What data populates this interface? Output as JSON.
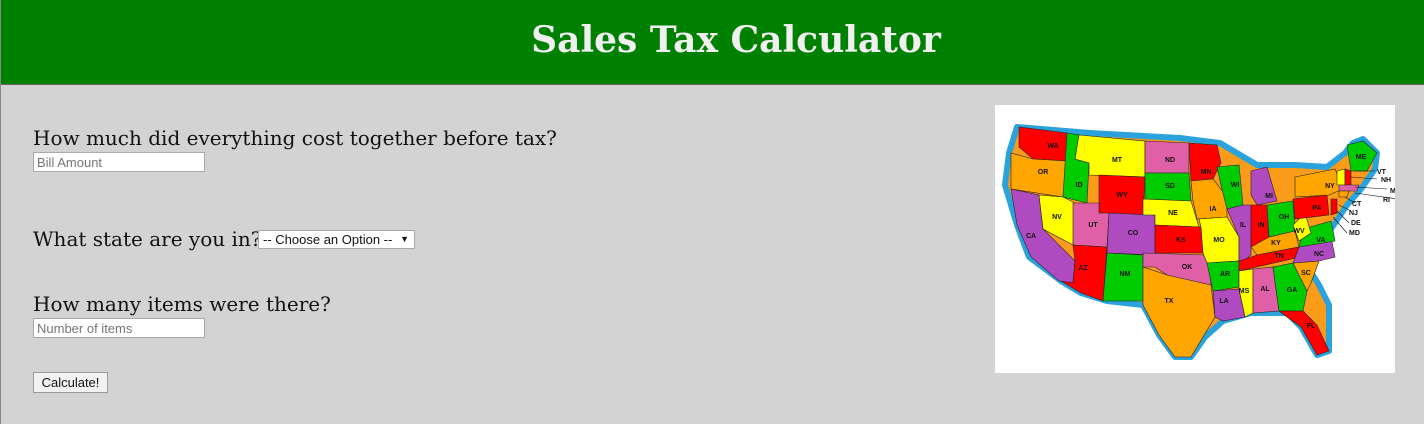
{
  "header": {
    "title": "Sales Tax Calculator"
  },
  "form": {
    "cost_question": "How much did everything cost together before tax?",
    "cost_placeholder": "Bill Amount",
    "state_question": "What state are you in?",
    "state_selected": "-- Choose an Option --",
    "items_question": "How many items were there?",
    "items_placeholder": "Number of items",
    "calculate_label": "Calculate!"
  },
  "map": {
    "state_labels": [
      "WA",
      "OR",
      "CA",
      "ID",
      "NV",
      "MT",
      "WY",
      "UT",
      "AZ",
      "CO",
      "NM",
      "ND",
      "SD",
      "NE",
      "KS",
      "OK",
      "TX",
      "MN",
      "IA",
      "MO",
      "AR",
      "LA",
      "WI",
      "IL",
      "MI",
      "IN",
      "OH",
      "KY",
      "TN",
      "MS",
      "AL",
      "GA",
      "FL",
      "SC",
      "NC",
      "VA",
      "WV",
      "PA",
      "NY",
      "ME",
      "VT",
      "NH",
      "MA",
      "RI",
      "CT",
      "NJ",
      "DE",
      "MD"
    ]
  },
  "colors": {
    "header_bg": "#008000",
    "page_bg": "#d3d3d3",
    "map_border": "#2aa3dc"
  }
}
